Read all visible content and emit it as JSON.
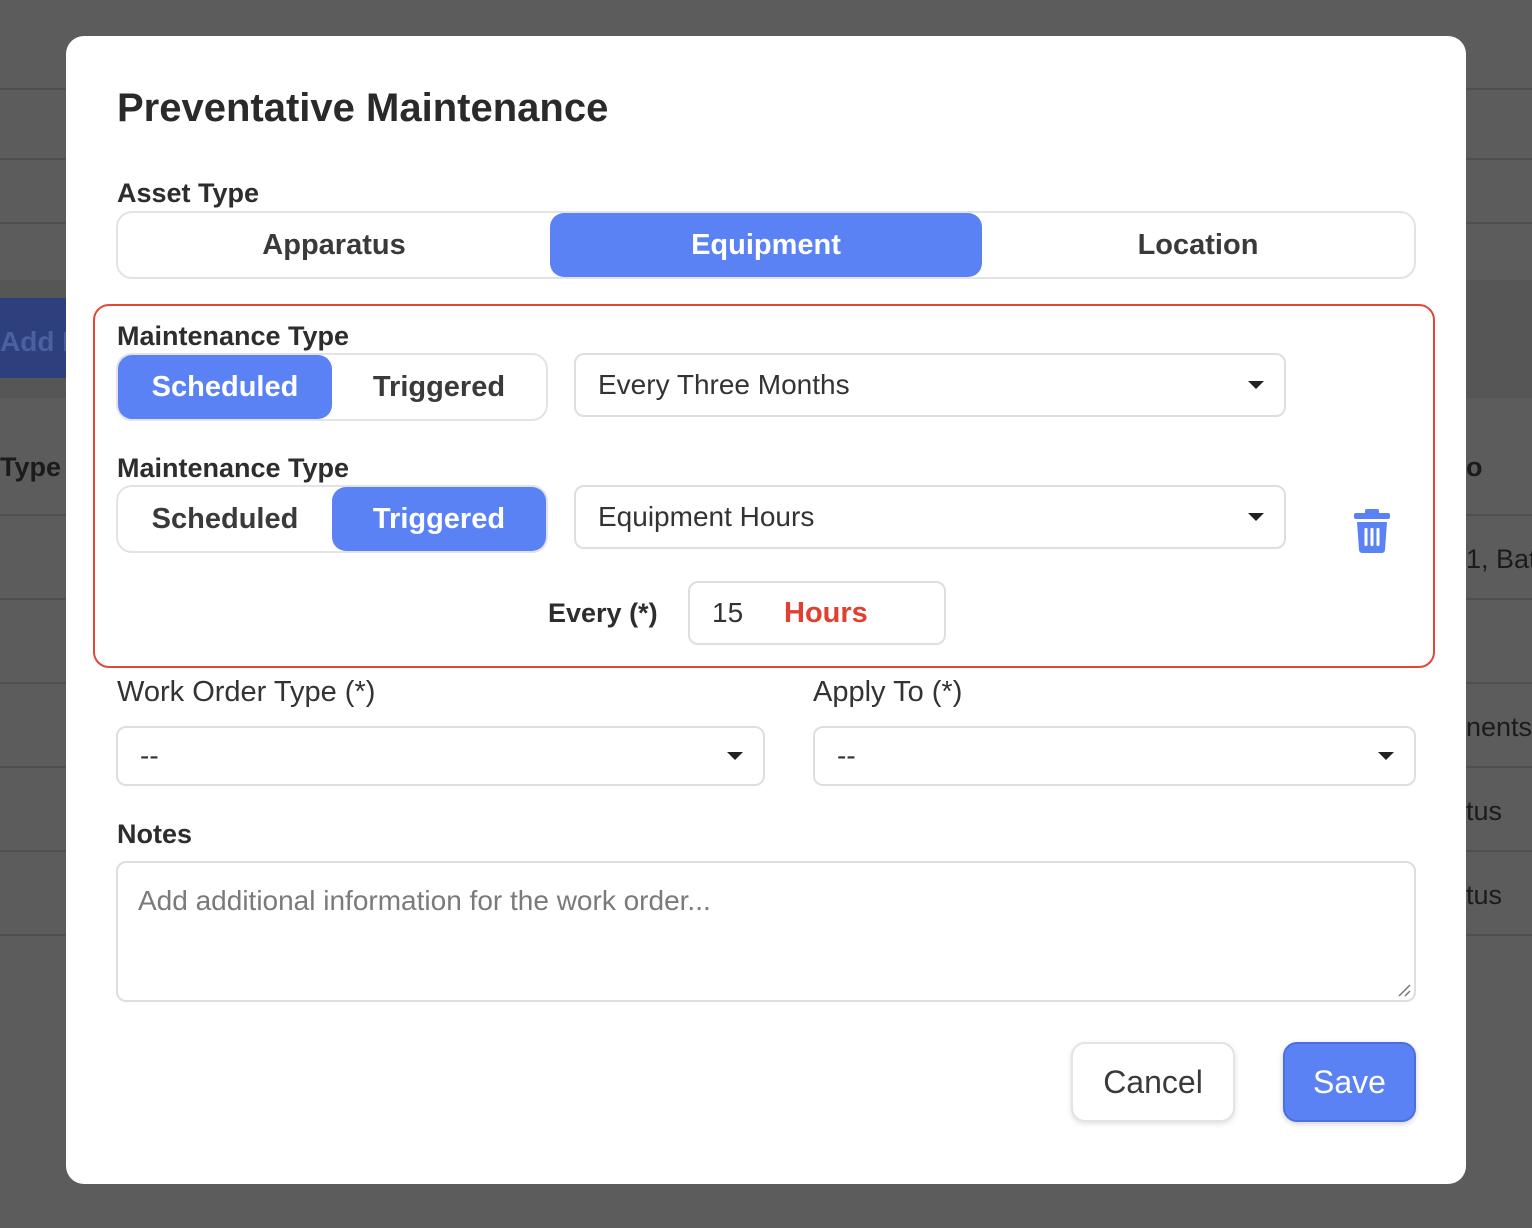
{
  "background": {
    "add_button_label": "Add N",
    "left_column_header": "Type",
    "right_fragments": [
      "o",
      "1, Bat",
      "nents",
      "tus",
      "tus"
    ]
  },
  "modal": {
    "title": "Preventative Maintenance",
    "asset_type": {
      "label": "Asset Type",
      "options": [
        "Apparatus",
        "Equipment",
        "Location"
      ],
      "selected": "Equipment"
    },
    "maintenance_rows": [
      {
        "label": "Maintenance Type",
        "options": [
          "Scheduled",
          "Triggered"
        ],
        "selected": "Scheduled",
        "select_value": "Every Three Months"
      },
      {
        "label": "Maintenance Type",
        "options": [
          "Scheduled",
          "Triggered"
        ],
        "selected": "Triggered",
        "select_value": "Equipment Hours",
        "every_label": "Every (*)",
        "every_value": "15",
        "every_unit": "Hours"
      }
    ],
    "work_order_type": {
      "label": "Work Order Type (*)",
      "value": "--"
    },
    "apply_to": {
      "label": "Apply To (*)",
      "value": "--"
    },
    "notes": {
      "label": "Notes",
      "placeholder": "Add additional information for the work order..."
    },
    "buttons": {
      "cancel": "Cancel",
      "save": "Save"
    }
  },
  "colors": {
    "accent": "#5a82f5",
    "highlight_border": "#e0483a",
    "unit_text": "#e0402f"
  },
  "icons": {
    "delete": "trash-icon",
    "dropdown": "caret-down-icon"
  }
}
